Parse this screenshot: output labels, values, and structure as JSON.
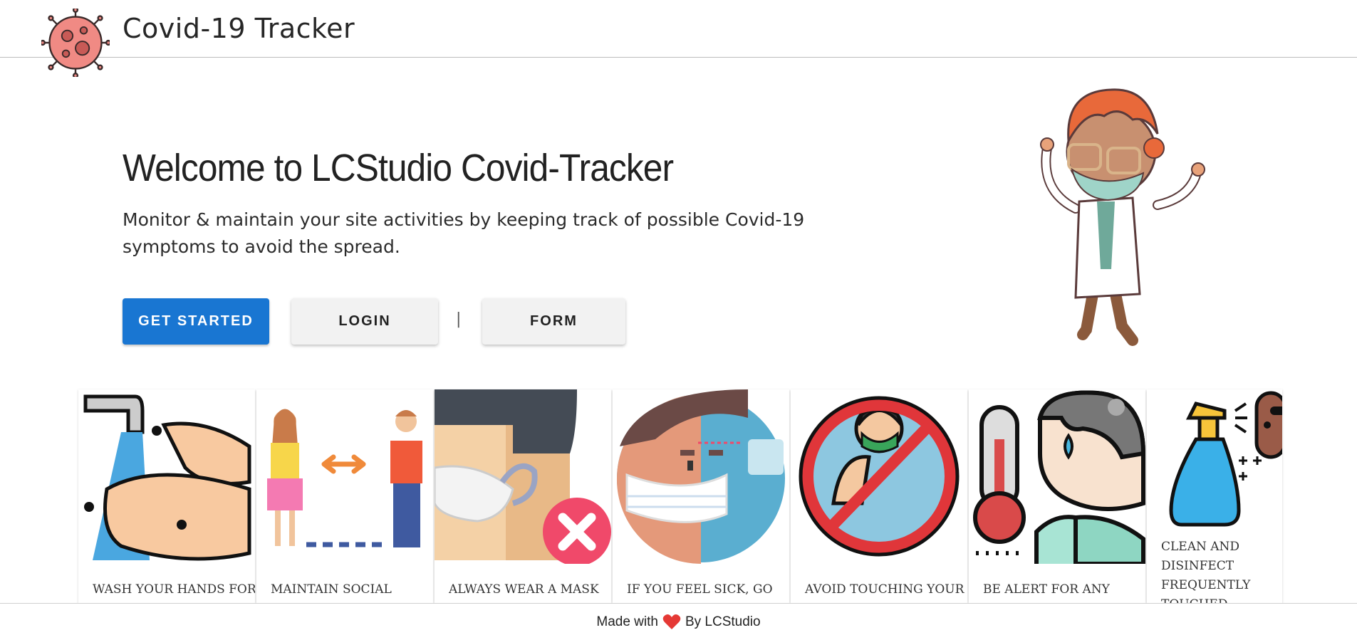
{
  "header": {
    "app_title": "Covid-19 Tracker",
    "logo_icon": "virus-icon"
  },
  "hero": {
    "title": "Welcome to LCStudio Covid-Tracker",
    "description": "Monitor & maintain your site activities by keeping track of possible Covid-19 symptoms to avoid the spread.",
    "buttons": {
      "get_started": "GET STARTED",
      "login": "LOGIN",
      "separator": "|",
      "form": "FORM"
    },
    "illustration": "doctor-illustration"
  },
  "cards": [
    {
      "icon": "hand-washing-icon",
      "text": "WASH YOUR HANDS FOR"
    },
    {
      "icon": "social-distance-icon",
      "text": "MAINTAIN SOCIAL"
    },
    {
      "icon": "mask-icon",
      "text": "ALWAYS WEAR A MASK"
    },
    {
      "icon": "sick-person-icon",
      "text": "IF YOU FEEL SICK, GO"
    },
    {
      "icon": "no-face-touch-icon",
      "text": "AVOID TOUCHING YOUR"
    },
    {
      "icon": "fever-thermometer-icon",
      "text": "BE ALERT FOR ANY"
    },
    {
      "icon": "disinfect-spray-icon",
      "text": "CLEAN AND DISINFECT FREQUENTLY TOUCHED"
    }
  ],
  "footer": {
    "made_with": "Made with",
    "by": "By LCStudio"
  },
  "colors": {
    "primary": "#1976d2",
    "heart": "#e53935"
  }
}
